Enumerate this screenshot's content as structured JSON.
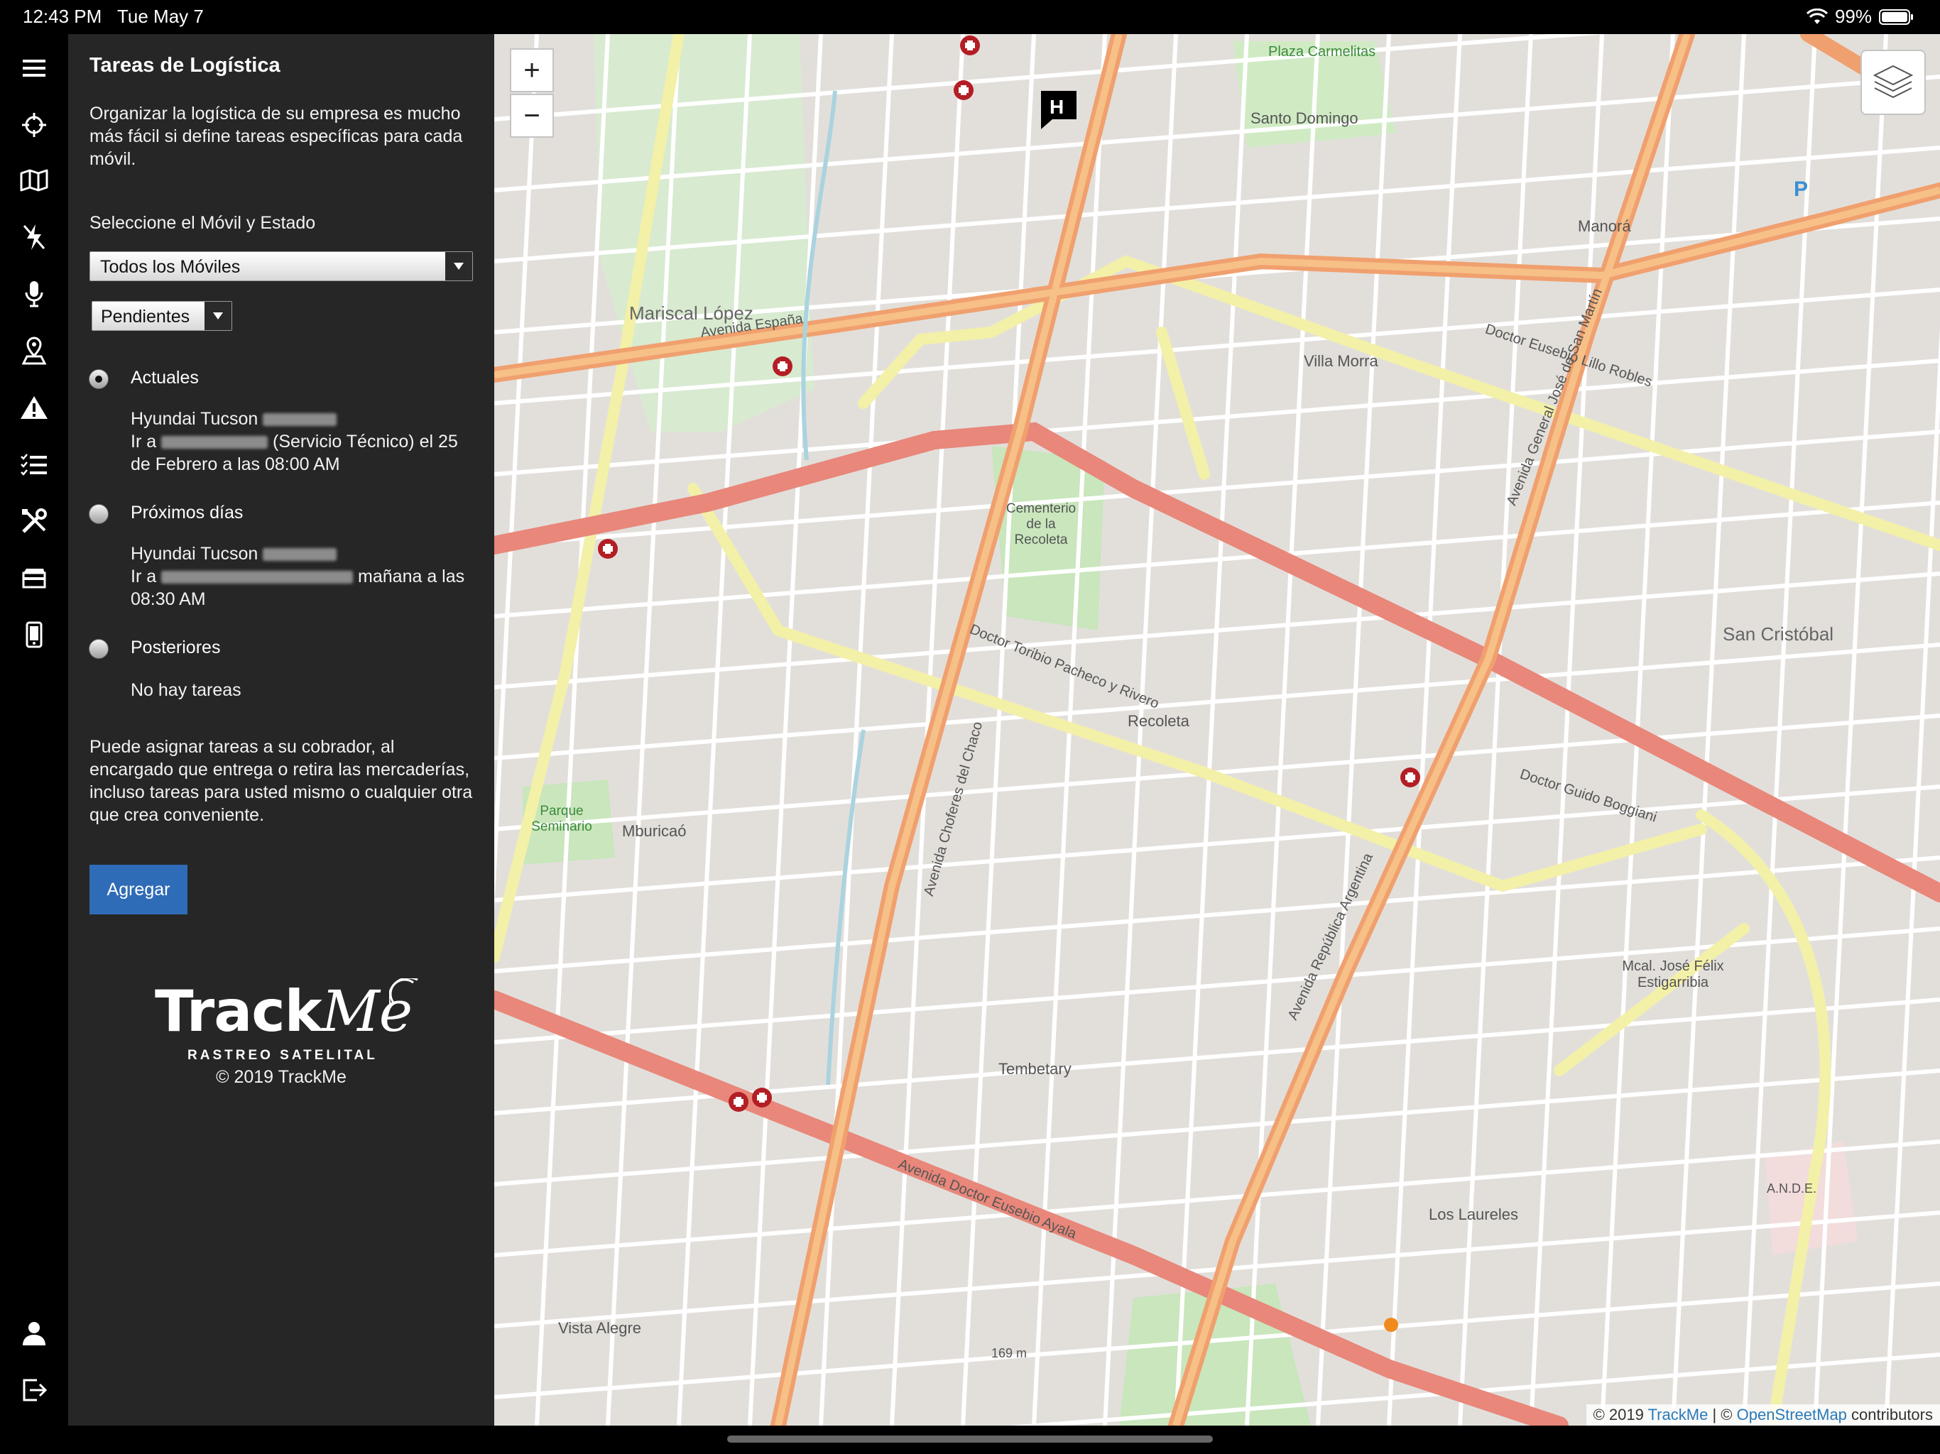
{
  "status_bar": {
    "time": "12:43 PM",
    "date": "Tue May 7",
    "battery": "99%"
  },
  "sidebar_icons": [
    "menu-icon",
    "target-icon",
    "map-icon",
    "flash-off-icon",
    "microphone-icon",
    "location-pin-icon",
    "warning-icon",
    "task-list-icon",
    "tools-icon",
    "card-icon",
    "mobile-icon",
    "user-icon",
    "logout-icon"
  ],
  "panel": {
    "title": "Tareas de Logística",
    "intro": "Organizar la logística de su empresa es mucho más fácil si define tareas específicas para cada móvil.",
    "select_label": "Seleccione el Móvil y Estado",
    "vehicle_select": "Todos los Móviles",
    "status_select": "Pendientes",
    "sections": [
      {
        "label": "Actuales",
        "selected": true,
        "vehicle": "Hyundai Tucson",
        "task_prefix": "Ir a",
        "task_text": "(Servicio Técnico) el 25 de Febrero a las 08:00 AM"
      },
      {
        "label": "Próximos días",
        "selected": false,
        "vehicle": "Hyundai Tucson",
        "task_prefix": "Ir a",
        "task_text": "mañana a las 08:30 AM"
      },
      {
        "label": "Posteriores",
        "selected": false,
        "empty_text": "No hay tareas"
      }
    ],
    "footer_text": "Puede asignar tareas a su cobrador, al encargado que entrega o retira las mercaderías, incluso tareas para usted mismo o cualquier otra que crea conveniente.",
    "add_button": "Agregar",
    "logo_text": "TrackMe",
    "logo_tagline": "RASTREO SATELITAL",
    "copyright": "© 2019 TrackMe"
  },
  "map": {
    "zoom_in": "+",
    "zoom_out": "−",
    "attribution_prefix": "© 2019",
    "attribution_trackme": "TrackMe",
    "attribution_sep": "| ©",
    "attribution_osm": "OpenStreetMap",
    "attribution_suffix": "contributors",
    "labels": [
      "Mariscal López",
      "Villa Morra",
      "Recoleta",
      "San Cristóbal",
      "Mburicaó",
      "Tembetary",
      "Manorá",
      "Santo Domingo",
      "Los Laureles",
      "Vista Alegre",
      "Mcal. José Félix Estigarribia",
      "Avenida España",
      "Avenida General José de San Martín",
      "Avenida República Argentina",
      "Avenida Doctor Eusebio Ayala",
      "Doctor Eusebio Lillo Robles",
      "Doctor Guido Boggiani",
      "Doctor Toribio Pacheco y Rivero",
      "Avenida Choferes del Chaco",
      "Cementerio de la Recoleta",
      "Parque Seminario",
      "Plaza Carmelitas",
      "A.N.D.E.",
      "169 m"
    ]
  },
  "colors": {
    "panel_bg": "#262626",
    "button_blue": "#2f6cb7",
    "major_road": "#f0a06e",
    "primary_road": "#e8877a",
    "secondary_road": "#f3f0a8",
    "park": "#c9e6bc"
  }
}
